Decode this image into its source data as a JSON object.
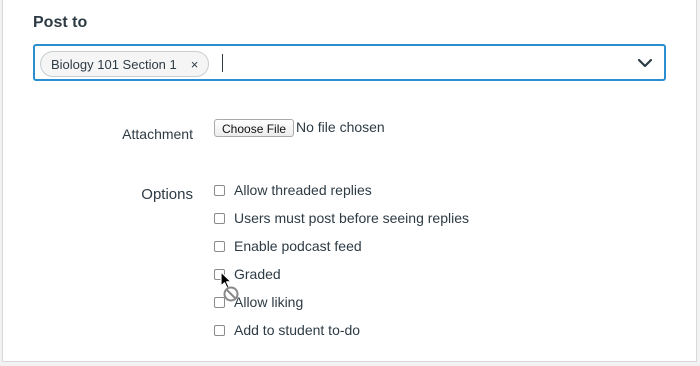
{
  "post_to": {
    "title": "Post to",
    "selected_chip": "Biology 101 Section 1",
    "chip_remove": "×"
  },
  "attachment": {
    "label": "Attachment",
    "button_label": "Choose File",
    "status": "No file chosen"
  },
  "options": {
    "label": "Options",
    "items": [
      {
        "label": "Allow threaded replies",
        "checked": false
      },
      {
        "label": "Users must post before seeing replies",
        "checked": false
      },
      {
        "label": "Enable podcast feed",
        "checked": false
      },
      {
        "label": "Graded",
        "checked": false
      },
      {
        "label": "Allow liking",
        "checked": false
      },
      {
        "label": "Add to student to-do",
        "checked": false
      }
    ]
  },
  "colors": {
    "focus_border": "#2a8fd0",
    "text": "#2d3b45"
  },
  "icons": {
    "chip_remove": "close-icon",
    "dropdown": "chevron-down-icon",
    "cursor": "mouse-pointer-not-allowed-icon"
  }
}
